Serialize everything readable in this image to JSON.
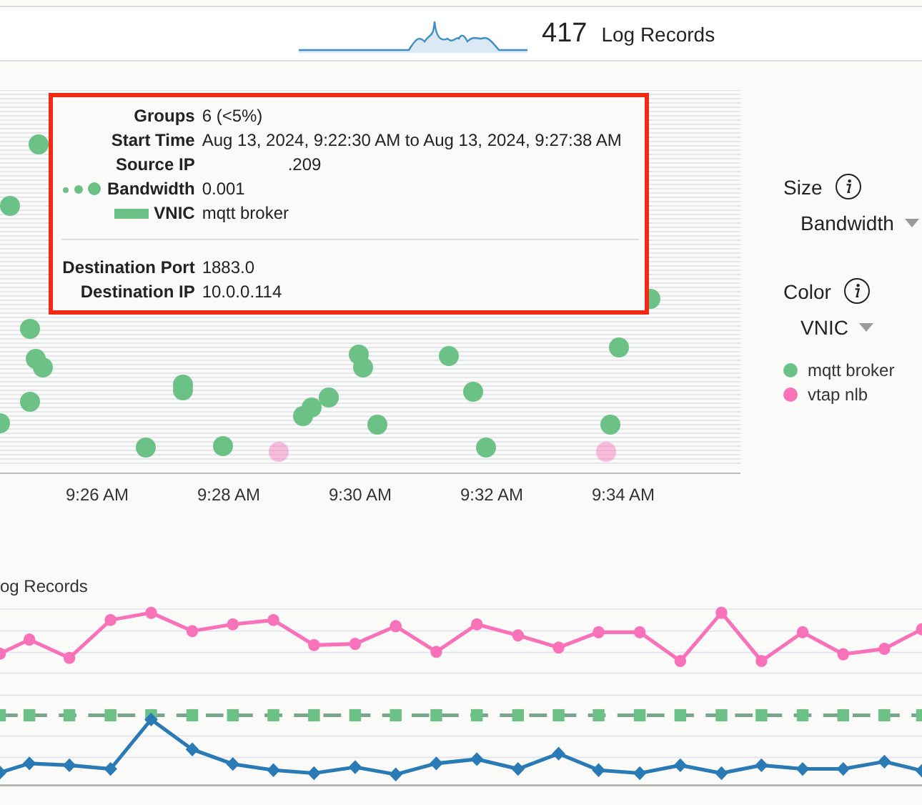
{
  "header": {
    "count": "417",
    "count_label": "Log Records"
  },
  "scatter": {
    "x_axis_labels": [
      "9:26 AM",
      "9:28 AM",
      "9:30 AM",
      "9:32 AM",
      "9:34 AM"
    ]
  },
  "tooltip": {
    "rows": [
      {
        "kind": "plain",
        "label": "Groups",
        "value": "6 (<5%)"
      },
      {
        "kind": "plain",
        "label": "Start Time",
        "value": "Aug 13, 2024, 9:22:30 AM to Aug 13, 2024, 9:27:38 AM"
      },
      {
        "kind": "redacted",
        "label": "Source IP",
        "value": ".209"
      },
      {
        "kind": "size",
        "label": "Bandwidth",
        "value": "0.001"
      },
      {
        "kind": "swatch",
        "label": "VNIC",
        "value": "mqtt broker",
        "color": "#6cc286"
      },
      {
        "kind": "divider"
      },
      {
        "kind": "plain",
        "label": "Destination Port",
        "value": "1883.0"
      },
      {
        "kind": "plain",
        "label": "Destination IP",
        "value": "10.0.0.114"
      }
    ]
  },
  "legend": {
    "size_label": "Size",
    "size_value": "Bandwidth",
    "color_label": "Color",
    "color_value": "VNIC",
    "items": [
      {
        "label": "mqtt broker",
        "color": "#6cc286"
      },
      {
        "label": "vtap nlb",
        "color": "#f772b9"
      }
    ]
  },
  "trend": {
    "title": "og Records"
  }
}
